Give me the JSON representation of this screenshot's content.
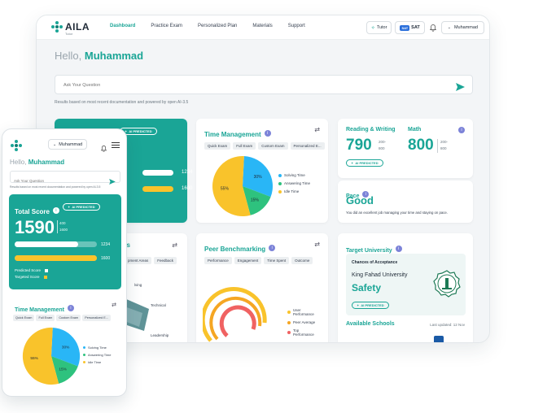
{
  "app": {
    "logo": "AILA",
    "logo_sub": "Tutor"
  },
  "nav": {
    "items": [
      "Dashboard",
      "Practice Exam",
      "Personalized Plan",
      "Materials",
      "Support"
    ],
    "active": "Dashboard"
  },
  "topbar": {
    "tutor_label": "Tutor",
    "sat_label": "SAT",
    "sat_badge": "SAT",
    "user_name": "Muhammad"
  },
  "greeting": {
    "hello": "Hello,",
    "name": "Muhammad"
  },
  "ask": {
    "placeholder": "Ask Your Question",
    "note": "Results based on most recent documentation and powered by open AI-3.5"
  },
  "ai_predicted": "AI PREDICTED",
  "total_score": {
    "title": "Total Score",
    "value": "1590",
    "range_low": "400",
    "range_high": "1600",
    "bar1_value": "1234",
    "bar2_value": "1600",
    "bar1_fraction": 0.77,
    "bar2_fraction": 1.0,
    "legend_predicted": "Predicted Score",
    "legend_targeted": "Targeted Score"
  },
  "time_management": {
    "title": "Time Management",
    "chips": [
      "Quick Exam",
      "Full Exam",
      "Custom Exam",
      "Personalized E..."
    ],
    "chart_data": {
      "type": "pie",
      "categories": [
        "Solving Time",
        "Answering Time",
        "Idle Time"
      ],
      "values": [
        30,
        15,
        55
      ],
      "labels": [
        "30%",
        "15%",
        "55%"
      ],
      "colors": [
        "#29b6f6",
        "#2ec27e",
        "#f9c32b"
      ]
    }
  },
  "reading_writing": {
    "title": "Reading & Writing",
    "value": "790",
    "range_low": "200-",
    "range_high": "800"
  },
  "math": {
    "title": "Math",
    "value": "800",
    "range_low": "200-",
    "range_high": "800"
  },
  "pace": {
    "title": "Pace",
    "value": "Good",
    "note": "You did an excellent job managing your time and staying on pace."
  },
  "peer_benchmarking": {
    "title": "Peer Benchmarking",
    "chips": [
      "Performance",
      "Engagement",
      "Time Spent",
      "Outcome"
    ],
    "legend": [
      "User Performance",
      "Peer Average",
      "Top Performance"
    ],
    "colors": [
      "#f9c32b",
      "#f5a623",
      "#f06262"
    ]
  },
  "skills": {
    "title_partial": "ss",
    "chips": [
      "pment Areas",
      "Feedback"
    ],
    "axis_labels": [
      "lving",
      "Technical",
      "Leadership"
    ]
  },
  "target_university": {
    "title": "Target University",
    "chances_label": "Chances of Acceptance",
    "university": "King Fahad University",
    "status": "Safety",
    "available_schools": "Available Schools",
    "last_updated": "Last updated: 12 Nov"
  },
  "colors": {
    "accent": "#1aa596",
    "yellow": "#f9c32b",
    "blue": "#29b6f6",
    "green": "#2ec27e",
    "red": "#f06262"
  }
}
